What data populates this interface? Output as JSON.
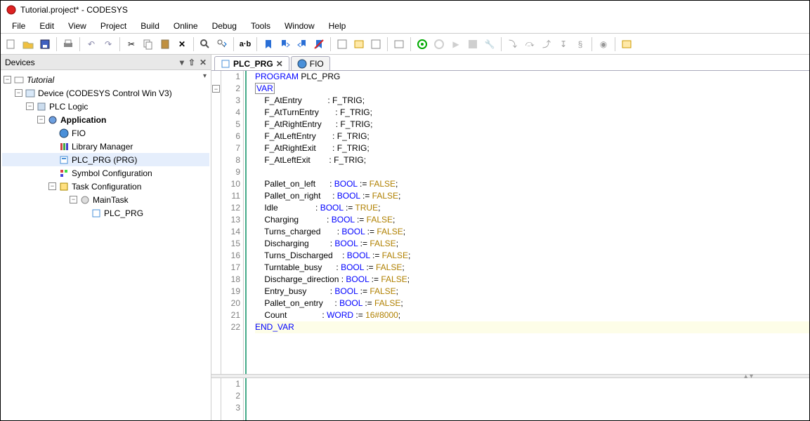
{
  "window": {
    "title": "Tutorial.project* - CODESYS"
  },
  "menu": [
    "File",
    "Edit",
    "View",
    "Project",
    "Build",
    "Online",
    "Debug",
    "Tools",
    "Window",
    "Help"
  ],
  "panel": {
    "title": "Devices"
  },
  "tree": {
    "root": "Tutorial",
    "device": "Device (CODESYS Control Win V3)",
    "plc_logic": "PLC Logic",
    "application": "Application",
    "fio": "FIO",
    "lib": "Library Manager",
    "prg": "PLC_PRG (PRG)",
    "sym": "Symbol Configuration",
    "task_cfg": "Task Configuration",
    "maintask": "MainTask",
    "task_prg": "PLC_PRG"
  },
  "tabs": {
    "active": "PLC_PRG",
    "other": "FIO"
  },
  "code": {
    "l1": "PROGRAM PLC_PRG",
    "l2k": "VAR",
    "l3a": "F_AtEntry",
    "l3t": "F_TRIG",
    "l4a": "F_AtTurnEntry",
    "l4t": "F_TRIG",
    "l5a": "F_AtRightEntry",
    "l5t": "F_TRIG",
    "l6a": "F_AtLeftEntry",
    "l6t": "F_TRIG",
    "l7a": "F_AtRightExit",
    "l7t": "F_TRIG",
    "l8a": "F_AtLeftExit",
    "l8t": "F_TRIG",
    "l10a": "Pallet_on_left",
    "l10t": "BOOL",
    "l10v": "FALSE",
    "l11a": "Pallet_on_right",
    "l11t": "BOOL",
    "l11v": "FALSE",
    "l12a": "Idle",
    "l12t": "BOOL",
    "l12v": "TRUE",
    "l13a": "Charging",
    "l13t": "BOOL",
    "l13v": "FALSE",
    "l14a": "Turns_charged",
    "l14t": "BOOL",
    "l14v": "FALSE",
    "l15a": "Discharging",
    "l15t": "BOOL",
    "l15v": "FALSE",
    "l16a": "Turns_Discharged",
    "l16t": "BOOL",
    "l16v": "FALSE",
    "l17a": "Turntable_busy",
    "l17t": "BOOL",
    "l17v": "FALSE",
    "l18a": "Discharge_direction",
    "l18t": "BOOL",
    "l18v": "FALSE",
    "l19a": "Entry_busy",
    "l19t": "BOOL",
    "l19v": "FALSE",
    "l20a": "Pallet_on_entry",
    "l20t": "BOOL",
    "l20v": "FALSE",
    "l21a": "Count",
    "l21t": "WORD",
    "l21v": "16#8000",
    "l22k": "END_VAR"
  },
  "gutter_top": [
    "1",
    "2",
    "3",
    "4",
    "5",
    "6",
    "7",
    "8",
    "9",
    "10",
    "11",
    "12",
    "13",
    "14",
    "15",
    "16",
    "17",
    "18",
    "19",
    "20",
    "21",
    "22"
  ],
  "gutter_bottom": [
    "1",
    "2",
    "3"
  ]
}
